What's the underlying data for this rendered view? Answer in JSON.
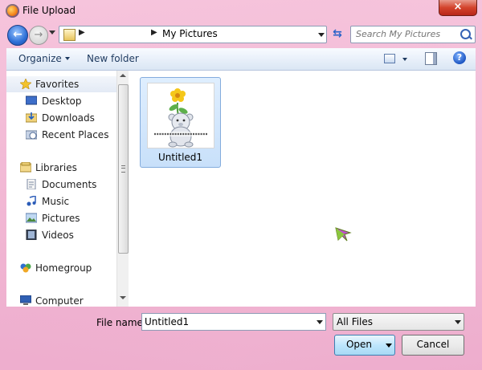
{
  "window": {
    "title": "File Upload",
    "close_symbol": "×"
  },
  "address": {
    "current_folder": "My Pictures"
  },
  "search": {
    "placeholder": "Search My Pictures"
  },
  "toolbar": {
    "organize_label": "Organize",
    "new_folder_label": "New folder",
    "help_symbol": "?"
  },
  "nav_pane": {
    "items": [
      {
        "label": "Favorites",
        "icon": "star-icon"
      },
      {
        "label": "Desktop",
        "icon": "desktop-icon"
      },
      {
        "label": "Downloads",
        "icon": "downloads-icon"
      },
      {
        "label": "Recent Places",
        "icon": "recent-places-icon"
      },
      {
        "label": "Libraries",
        "icon": "libraries-icon"
      },
      {
        "label": "Documents",
        "icon": "documents-icon"
      },
      {
        "label": "Music",
        "icon": "music-icon"
      },
      {
        "label": "Pictures",
        "icon": "pictures-icon"
      },
      {
        "label": "Videos",
        "icon": "videos-icon"
      },
      {
        "label": "Homegroup",
        "icon": "homegroup-icon"
      },
      {
        "label": "Computer",
        "icon": "computer-icon"
      }
    ]
  },
  "files": [
    {
      "name": "Untitled1",
      "selected": true
    }
  ],
  "footer": {
    "file_name_label": "File name:",
    "file_name_value": "Untitled1",
    "file_type_value": "All Files",
    "open_label": "Open",
    "cancel_label": "Cancel"
  },
  "colors": {
    "frame_pink": "#eeaece",
    "selection_blue": "#c8e0fa",
    "open_button_blue": "#bee6fd",
    "close_button_red": "#d3432c"
  }
}
